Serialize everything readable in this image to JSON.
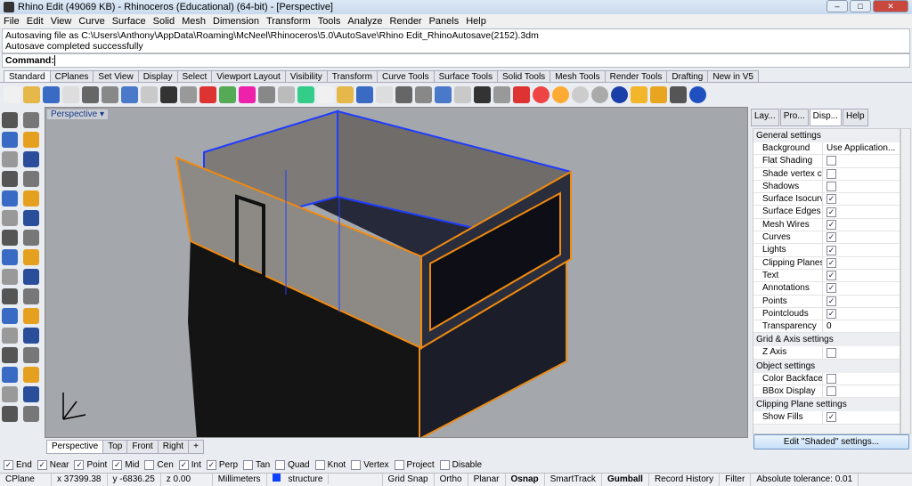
{
  "window": {
    "title": "Rhino Edit (49069 KB) - Rhinoceros (Educational) (64-bit) - [Perspective]"
  },
  "menu": [
    "File",
    "Edit",
    "View",
    "Curve",
    "Surface",
    "Solid",
    "Mesh",
    "Dimension",
    "Transform",
    "Tools",
    "Analyze",
    "Render",
    "Panels",
    "Help"
  ],
  "history": [
    "Autosaving file as C:\\Users\\Anthony\\AppData\\Roaming\\McNeel\\Rhinoceros\\5.0\\AutoSave\\Rhino Edit_RhinoAutosave(2152).3dm",
    "Autosave completed successfully"
  ],
  "command": {
    "label": "Command:",
    "value": ""
  },
  "toolbar_tabs": [
    "Standard",
    "CPlanes",
    "Set View",
    "Display",
    "Select",
    "Viewport Layout",
    "Visibility",
    "Transform",
    "Curve Tools",
    "Surface Tools",
    "Solid Tools",
    "Mesh Tools",
    "Render Tools",
    "Drafting",
    "New in V5"
  ],
  "viewport": {
    "label": "Perspective",
    "tabs": [
      "Perspective",
      "Top",
      "Front",
      "Right",
      "+"
    ]
  },
  "panel": {
    "tabs": [
      "Lay...",
      "Pro...",
      "Disp...",
      "Help"
    ],
    "sections": [
      {
        "title": "General settings",
        "rows": [
          {
            "label": "Background",
            "value": "Use Application..."
          },
          {
            "label": "Flat Shading",
            "checked": false
          },
          {
            "label": "Shade vertex colors",
            "checked": false
          },
          {
            "label": "Shadows",
            "checked": false
          },
          {
            "label": "Surface Isocurves",
            "checked": true
          },
          {
            "label": "Surface Edges",
            "checked": true
          },
          {
            "label": "Mesh Wires",
            "checked": true
          },
          {
            "label": "Curves",
            "checked": true
          },
          {
            "label": "Lights",
            "checked": true
          },
          {
            "label": "Clipping Planes",
            "checked": true
          },
          {
            "label": "Text",
            "checked": true
          },
          {
            "label": "Annotations",
            "checked": true
          },
          {
            "label": "Points",
            "checked": true
          },
          {
            "label": "Pointclouds",
            "checked": true
          },
          {
            "label": "Transparency",
            "value": "0"
          }
        ]
      },
      {
        "title": "Grid & Axis settings",
        "rows": [
          {
            "label": "Z Axis",
            "checked": false
          }
        ]
      },
      {
        "title": "Object settings",
        "rows": [
          {
            "label": "Color Backfaces",
            "checked": false
          },
          {
            "label": "BBox Display",
            "checked": false
          }
        ]
      },
      {
        "title": "Clipping Plane settings",
        "rows": [
          {
            "label": "Show Fills",
            "checked": true
          }
        ]
      }
    ],
    "edit_button": "Edit \"Shaded\" settings..."
  },
  "osnap": [
    {
      "label": "End",
      "checked": true
    },
    {
      "label": "Near",
      "checked": true
    },
    {
      "label": "Point",
      "checked": true
    },
    {
      "label": "Mid",
      "checked": true
    },
    {
      "label": "Cen",
      "checked": false
    },
    {
      "label": "Int",
      "checked": true
    },
    {
      "label": "Perp",
      "checked": true
    },
    {
      "label": "Tan",
      "checked": false
    },
    {
      "label": "Quad",
      "checked": false
    },
    {
      "label": "Knot",
      "checked": false
    },
    {
      "label": "Vertex",
      "checked": false
    },
    {
      "label": "Project",
      "checked": false
    },
    {
      "label": "Disable",
      "checked": false
    }
  ],
  "status": {
    "cplane": "CPlane",
    "x": "x 37399.38",
    "y": "y -6836.25",
    "z": "z 0.00",
    "units": "Millimeters",
    "layer": "structure",
    "layer_color": "#1040ff",
    "toggles": [
      {
        "label": "Grid Snap",
        "on": false
      },
      {
        "label": "Ortho",
        "on": false
      },
      {
        "label": "Planar",
        "on": false
      },
      {
        "label": "Osnap",
        "on": true
      },
      {
        "label": "SmartTrack",
        "on": false
      },
      {
        "label": "Gumball",
        "on": true
      },
      {
        "label": "Record History",
        "on": false
      },
      {
        "label": "Filter",
        "on": false
      }
    ],
    "tolerance": "Absolute tolerance: 0.01"
  }
}
